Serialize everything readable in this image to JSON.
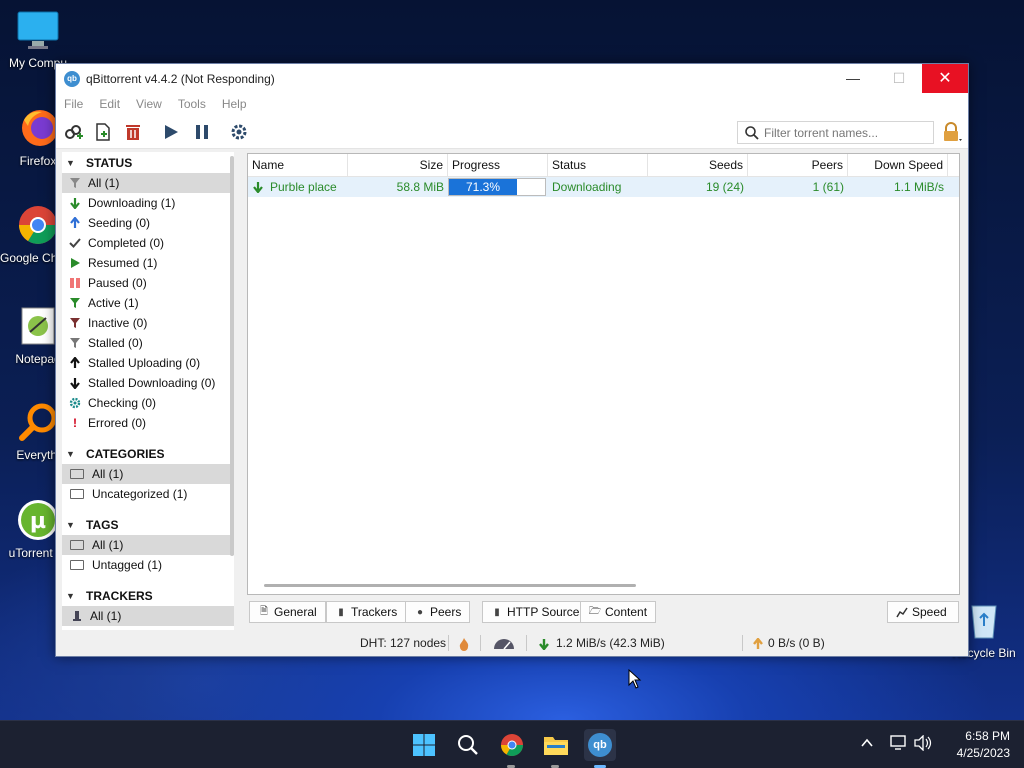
{
  "desktop": {
    "icons": [
      {
        "label": "My Compu"
      },
      {
        "label": "Firefox"
      },
      {
        "label": "Google Chrom"
      },
      {
        "label": "Notepad"
      },
      {
        "label": "Everythi"
      },
      {
        "label": "uTorrent W"
      },
      {
        "label": "Recycle Bin"
      }
    ]
  },
  "window": {
    "title": "qBittorrent v4.4.2 (Not Responding)",
    "app_icon_text": "qb",
    "menu": [
      "File",
      "Edit",
      "View",
      "Tools",
      "Help"
    ],
    "search_placeholder": "Filter torrent names..."
  },
  "sidebar": {
    "status_header": "STATUS",
    "status_items": [
      {
        "label": "All (1)",
        "icon": "filter-icon",
        "selected": true
      },
      {
        "label": "Downloading (1)",
        "icon": "arrow-down-icon"
      },
      {
        "label": "Seeding (0)",
        "icon": "arrow-up-icon"
      },
      {
        "label": "Completed (0)",
        "icon": "checkmark-icon"
      },
      {
        "label": "Resumed (1)",
        "icon": "play-icon"
      },
      {
        "label": "Paused (0)",
        "icon": "pause-icon"
      },
      {
        "label": "Active (1)",
        "icon": "filter-icon"
      },
      {
        "label": "Inactive (0)",
        "icon": "filter-icon"
      },
      {
        "label": "Stalled (0)",
        "icon": "filter-icon"
      },
      {
        "label": "Stalled Uploading (0)",
        "icon": "arrow-up-icon"
      },
      {
        "label": "Stalled Downloading (0)",
        "icon": "arrow-down-icon"
      },
      {
        "label": "Checking (0)",
        "icon": "gear-icon"
      },
      {
        "label": "Errored (0)",
        "icon": "exclamation-icon"
      }
    ],
    "categories_header": "CATEGORIES",
    "categories": [
      {
        "label": "All (1)",
        "selected": true
      },
      {
        "label": "Uncategorized (1)"
      }
    ],
    "tags_header": "TAGS",
    "tags": [
      {
        "label": "All (1)",
        "selected": true
      },
      {
        "label": "Untagged (1)"
      }
    ],
    "trackers_header": "TRACKERS",
    "trackers": [
      {
        "label": "All (1)",
        "selected": true
      }
    ]
  },
  "table": {
    "columns": [
      "Name",
      "Size",
      "Progress",
      "Status",
      "Seeds",
      "Peers",
      "Down Speed"
    ],
    "rows": [
      {
        "name": "Purble place",
        "size": "58.8 MiB",
        "progress": "71.3%",
        "progress_value": 0.713,
        "status": "Downloading",
        "seeds": "19 (24)",
        "peers": "1 (61)",
        "down_speed": "1.1 MiB/s"
      }
    ]
  },
  "bottom_tabs": [
    "General",
    "Trackers",
    "Peers",
    "HTTP Sources",
    "Content"
  ],
  "speed_button": "Speed",
  "statusbar": {
    "dht": "DHT: 127 nodes",
    "download": "1.2 MiB/s (42.3 MiB)",
    "upload": "0 B/s (0 B)"
  },
  "taskbar": {
    "time": "6:58 PM",
    "date": "4/25/2023",
    "qb_icon_text": "qb"
  },
  "colors": {
    "accent": "#1a73d9",
    "downloading_text": "#2a8b2a",
    "close_button": "#e81123"
  }
}
